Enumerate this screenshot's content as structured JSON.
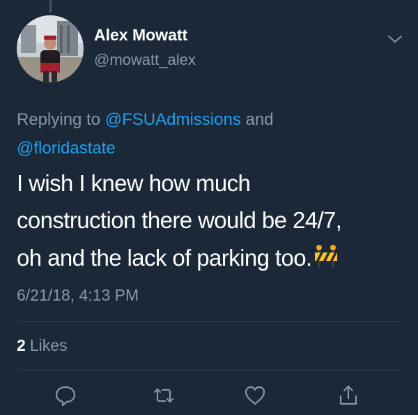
{
  "user": {
    "display_name": "Alex Mowatt",
    "handle": "@mowatt_alex",
    "avatar_icon": "profile-photo"
  },
  "reply": {
    "prefix": "Replying to ",
    "mention_1": "@FSUAdmissions",
    "conjunction": " and",
    "mention_2": "@floridastate"
  },
  "tweet": {
    "line_1": "I wish I knew how much",
    "line_2": "construction there would be 24/7,",
    "line_3": "oh and the lack of parking too.",
    "emoji": "construction-sign-icon"
  },
  "timestamp": "6/21/18, 4:13 PM",
  "stats": {
    "likes_count": "2",
    "likes_label": "Likes"
  },
  "actions": [
    "reply-icon",
    "retweet-icon",
    "like-icon",
    "share-icon"
  ],
  "colors": {
    "background": "#1b2837",
    "text": "#ffffff",
    "secondary": "#8899a6",
    "link": "#1da1f2",
    "divider": "#38444d"
  }
}
